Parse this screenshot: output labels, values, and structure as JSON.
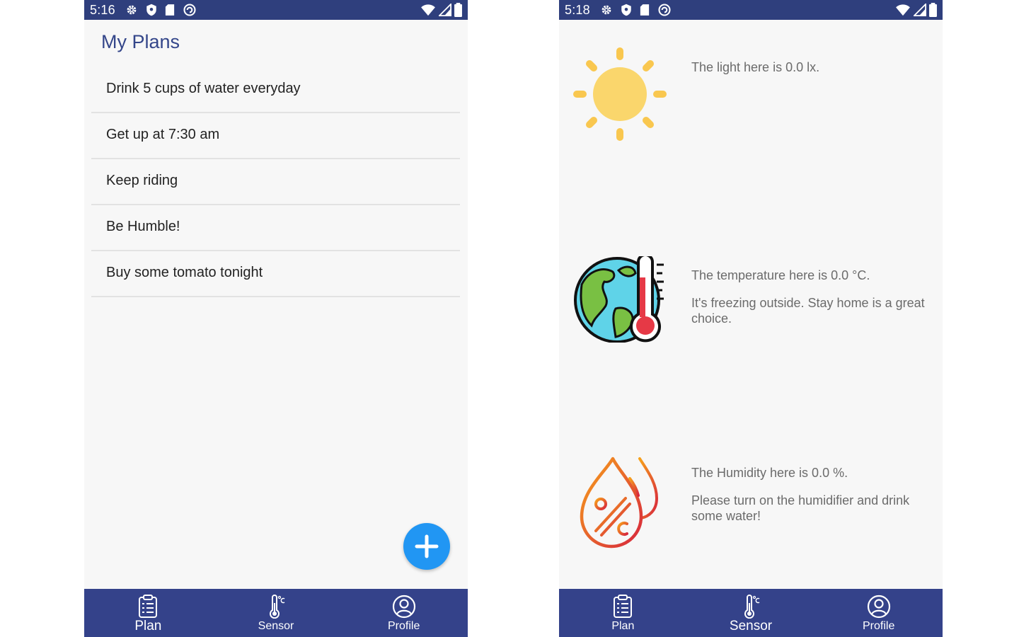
{
  "left_screen": {
    "status": {
      "time": "5:16"
    },
    "title": "My Plans",
    "plans": [
      "Drink 5 cups of water everyday",
      "Get up at 7:30 am",
      "Keep riding",
      "Be Humble!",
      "Buy some tomato tonight"
    ],
    "nav": {
      "plan": "Plan",
      "sensor": "Sensor",
      "profile": "Profile",
      "active": "plan"
    }
  },
  "right_screen": {
    "status": {
      "time": "5:18"
    },
    "light": {
      "text": "The light here is 0.0 lx.",
      "icon": "sun-icon"
    },
    "temperature": {
      "text": "The temperature here is 0.0 °C.",
      "advice": "It's freezing outside. Stay home is a great choice.",
      "icon": "globe-thermometer-icon"
    },
    "humidity": {
      "text": "The Humidity here is 0.0 %.",
      "advice": "Please turn on the humidifier and drink some water!",
      "icon": "humidity-drops-icon"
    },
    "nav": {
      "plan": "Plan",
      "sensor": "Sensor",
      "profile": "Profile",
      "active": "sensor"
    }
  },
  "colors": {
    "primary": "#34428a",
    "status_bar": "#2f3f7d",
    "title": "#34468a",
    "fab": "#2196f3",
    "sun": "#f9c74f"
  }
}
